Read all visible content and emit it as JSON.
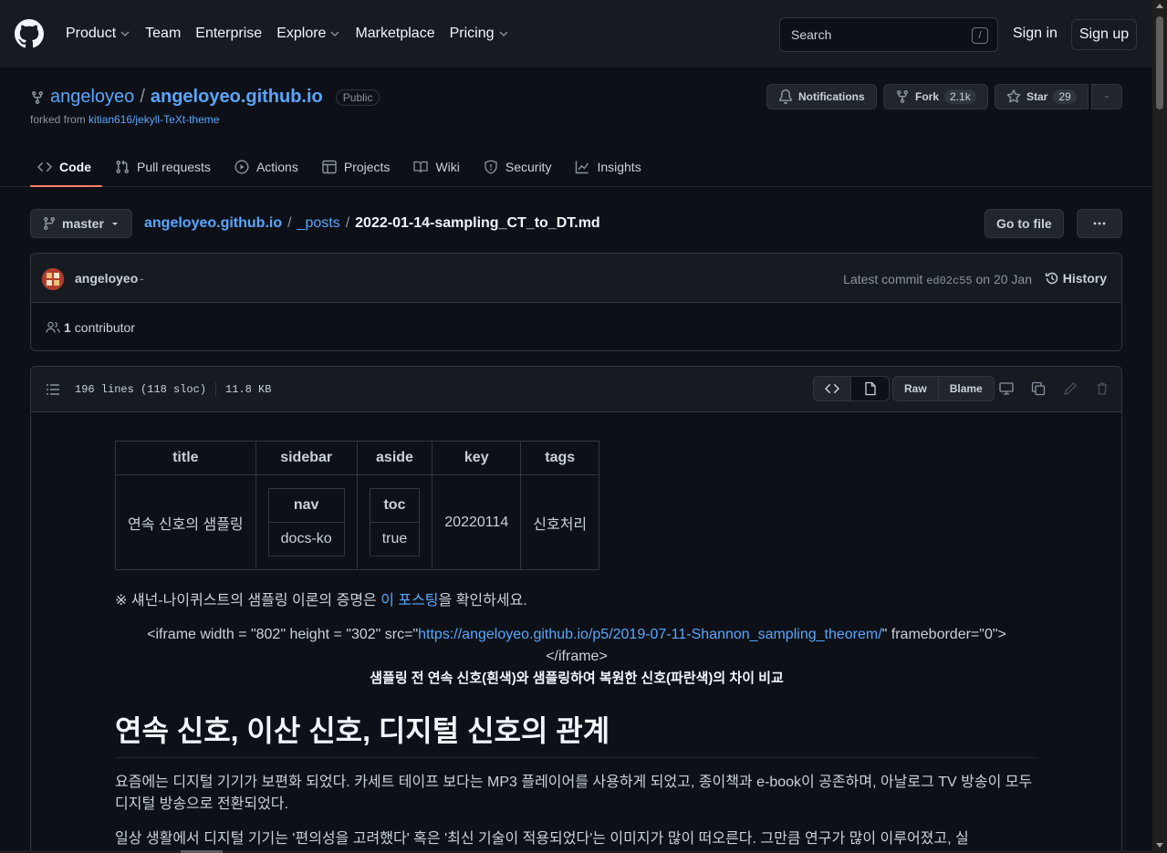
{
  "header": {
    "nav": [
      {
        "label": "Product",
        "dropdown": true
      },
      {
        "label": "Team",
        "dropdown": false
      },
      {
        "label": "Enterprise",
        "dropdown": false
      },
      {
        "label": "Explore",
        "dropdown": true
      },
      {
        "label": "Marketplace",
        "dropdown": false
      },
      {
        "label": "Pricing",
        "dropdown": true
      }
    ],
    "search_placeholder": "Search",
    "search_shortcut": "/",
    "signin": "Sign in",
    "signup": "Sign up"
  },
  "repo": {
    "owner": "angeloyeo",
    "separator": "/",
    "name": "angeloyeo.github.io",
    "visibility": "Public",
    "forked_prefix": "forked from",
    "forked_from": "kitian616/jekyll-TeXt-theme",
    "notifications": "Notifications",
    "fork_label": "Fork",
    "fork_count": "2.1k",
    "star_label": "Star",
    "star_count": "29"
  },
  "tabs": [
    {
      "label": "Code",
      "icon": "code-icon",
      "active": true
    },
    {
      "label": "Pull requests",
      "icon": "pull-request-icon",
      "active": false
    },
    {
      "label": "Actions",
      "icon": "play-icon",
      "active": false
    },
    {
      "label": "Projects",
      "icon": "table-icon",
      "active": false
    },
    {
      "label": "Wiki",
      "icon": "book-icon",
      "active": false
    },
    {
      "label": "Security",
      "icon": "shield-icon",
      "active": false
    },
    {
      "label": "Insights",
      "icon": "graph-icon",
      "active": false
    }
  ],
  "breadcrumb": {
    "branch": "master",
    "root": "angeloyeo.github.io",
    "folder": "_posts",
    "file": "2022-01-14-sampling_CT_to_DT.md",
    "sep": "/",
    "goto": "Go to file",
    "more": "···"
  },
  "commit": {
    "author": "angeloyeo",
    "dash": "-",
    "latest_prefix": "Latest commit",
    "sha": "ed02c55",
    "date": "on 20 Jan",
    "history": "History",
    "contributors_count": "1",
    "contributors_label": "contributor"
  },
  "file": {
    "lines": "196 lines (118 sloc)",
    "size": "11.8 KB",
    "raw": "Raw",
    "blame": "Blame"
  },
  "content": {
    "table": {
      "headers": [
        "title",
        "sidebar",
        "aside",
        "key",
        "tags"
      ],
      "title": "연속 신호의 샘플링",
      "sidebar_head": "nav",
      "sidebar_val": "docs-ko",
      "aside_head": "toc",
      "aside_val": "true",
      "key": "20220114",
      "tags": "신호처리"
    },
    "note_prefix": "※ 섀넌-나이퀴스트의 샘플링 이론의 증명은 ",
    "note_link": "이 포스팅",
    "note_suffix": "을 확인하세요.",
    "iframe_prefix": "<iframe width = \"802\" height = \"302\" src=\"",
    "iframe_url": "https://angeloyeo.github.io/p5/2019-07-11-Shannon_sampling_theorem/",
    "iframe_suffix": "\" frameborder=\"0\">",
    "iframe_close": "</iframe>",
    "caption": "샘플링 전 연속 신호(흰색)와 샘플링하여 복원한 신호(파란색)의 차이 비교",
    "h1": "연속 신호, 이산 신호, 디지털 신호의 관계",
    "p1": "요즘에는 디지털 기기가 보편화 되었다. 카세트 테이프 보다는 MP3 플레이어를 사용하게 되었고, 종이책과 e-book이 공존하며, 아날로그 TV 방송이 모두 디지털 방송으로 전환되었다.",
    "p2": "일상 생활에서 디지털 기기는 '편의성을 고려했다' 혹은 '최신 기술이 적용되었다'는 이미지가 많이 떠오른다. 그만큼 연구가 많이 이루어졌고, 실"
  }
}
